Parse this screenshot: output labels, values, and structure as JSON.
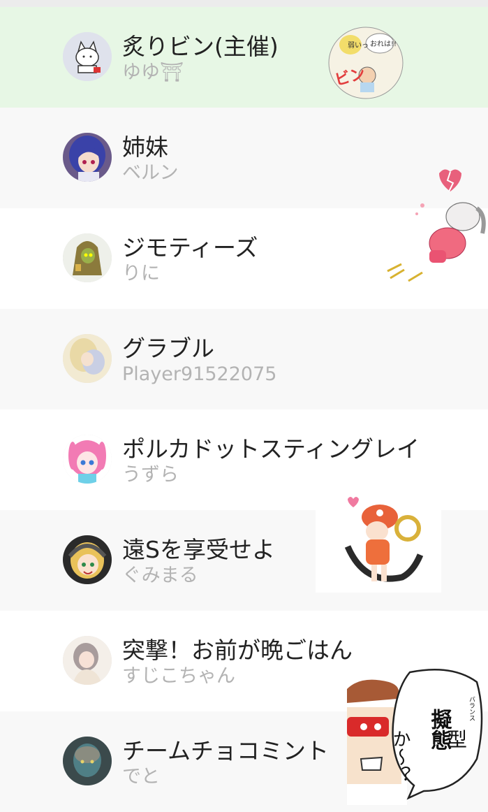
{
  "groups": [
    {
      "title": "炙りビン(主催)",
      "subtitle": "ゆゆ⛩",
      "avatar_icon": "white-cat-avatar-icon"
    },
    {
      "title": "姉妹",
      "subtitle": "ベルン",
      "avatar_icon": "blue-hair-girl-avatar-icon"
    },
    {
      "title": "ジモティーズ",
      "subtitle": "りに",
      "avatar_icon": "tonberry-avatar-icon"
    },
    {
      "title": "グラブル",
      "subtitle": "Player91522075",
      "avatar_icon": "blurred-character-avatar-icon"
    },
    {
      "title": "ポルカドットスティングレイ",
      "subtitle": "うずら",
      "avatar_icon": "pink-hair-girl-avatar-icon"
    },
    {
      "title": "遠Sを享受せよ",
      "subtitle": "ぐみまる",
      "avatar_icon": "blonde-girl-headphones-avatar-icon"
    },
    {
      "title": "突撃！お前が晩ごはん",
      "subtitle": "すじこちゃん",
      "avatar_icon": "gray-hair-girl-avatar-icon"
    },
    {
      "title": "チームチョコミント",
      "subtitle": "でと",
      "avatar_icon": "dark-creature-avatar-icon"
    }
  ],
  "stickers": {
    "bin_sticker_text": "ビン",
    "bin_sticker_small_1": "おれは!!",
    "bin_sticker_small_2": "弱いっ",
    "cartoon_bubble_line1": "擬態",
    "cartoon_bubble_line2": "型",
    "cartoon_bubble_line3": "か〜？",
    "cartoon_bubble_ruby": "バランス"
  },
  "colors": {
    "highlight_row": "#e7f7e5",
    "alt_row": "#f8f8f8",
    "title_text": "#222222",
    "subtitle_text": "#b3b3b3"
  }
}
